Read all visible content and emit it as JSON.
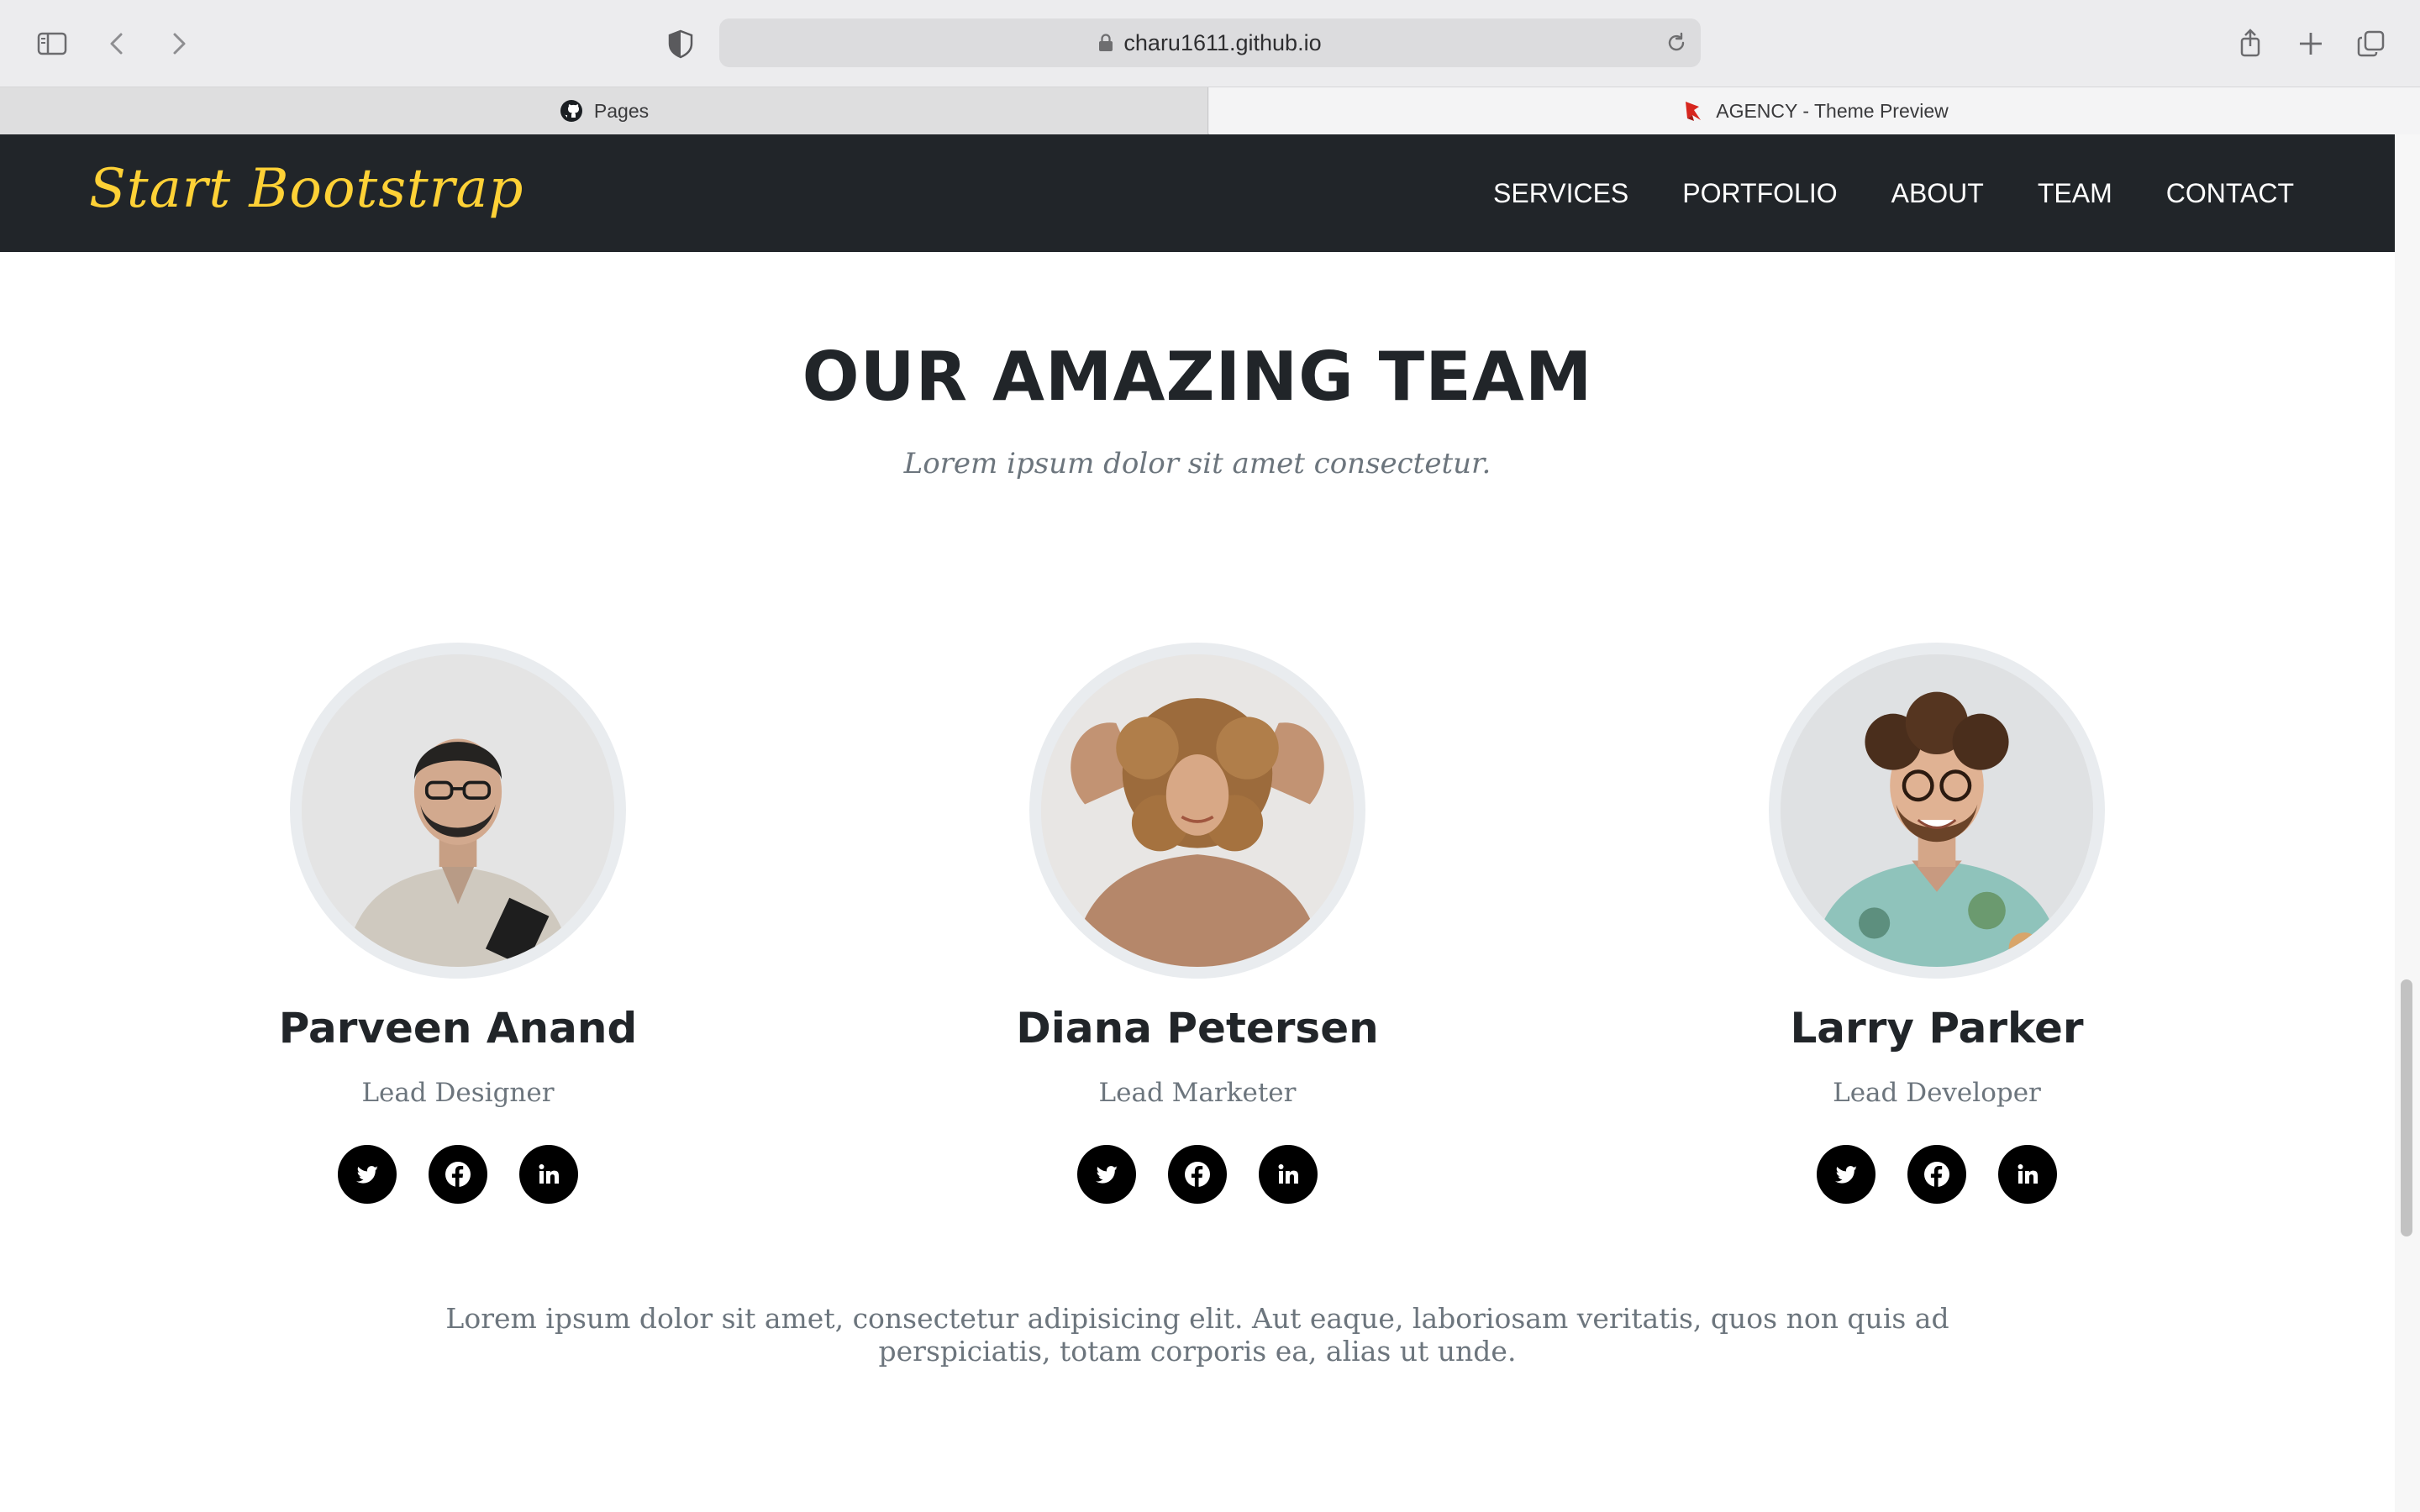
{
  "browser": {
    "url": "charu1611.github.io",
    "tabs": [
      {
        "label": "Pages",
        "icon": "github-icon",
        "active": false
      },
      {
        "label": "AGENCY - Theme Preview",
        "icon": "bootstrap-favicon",
        "active": true
      }
    ]
  },
  "nav": {
    "brand": "Start Bootstrap",
    "brand_color": "#fed136",
    "links": [
      "SERVICES",
      "PORTFOLIO",
      "ABOUT",
      "TEAM",
      "CONTACT"
    ]
  },
  "team": {
    "heading": "OUR AMAZING TEAM",
    "subheading": "Lorem ipsum dolor sit amet consectetur.",
    "members": [
      {
        "name": "Parveen Anand",
        "role": "Lead Designer",
        "socials": [
          "twitter-icon",
          "facebook-icon",
          "linkedin-icon"
        ]
      },
      {
        "name": "Diana Petersen",
        "role": "Lead Marketer",
        "socials": [
          "twitter-icon",
          "facebook-icon",
          "linkedin-icon"
        ]
      },
      {
        "name": "Larry Parker",
        "role": "Lead Developer",
        "socials": [
          "twitter-icon",
          "facebook-icon",
          "linkedin-icon"
        ]
      }
    ],
    "footer_text": "Lorem ipsum dolor sit amet, consectetur adipisicing elit. Aut eaque, laboriosam veritatis, quos non quis ad perspiciatis, totam corporis ea, alias ut unde."
  }
}
